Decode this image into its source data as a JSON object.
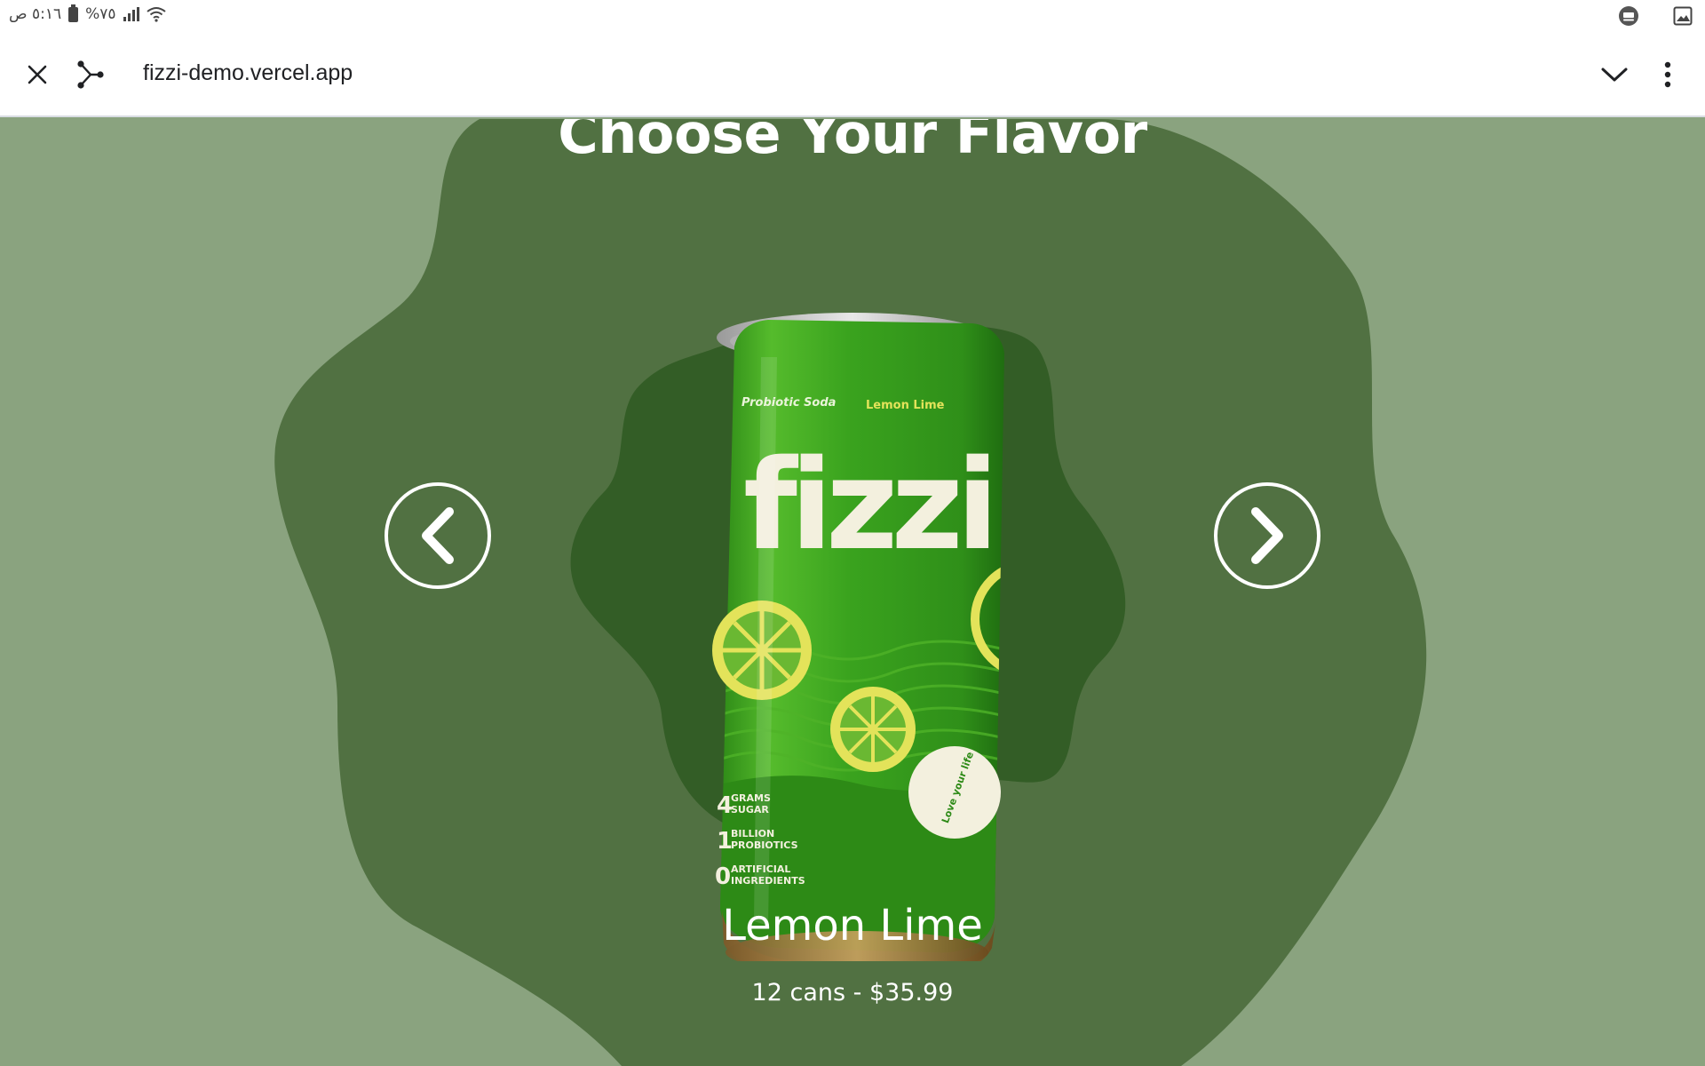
{
  "status_bar": {
    "time": "٥:١٦ ص",
    "battery": "%٧٥"
  },
  "browser": {
    "url": "fizzi-demo.vercel.app"
  },
  "page": {
    "heading": "Choose Your Flavor",
    "flavor_name": "Lemon Lime",
    "price": "12 cans - $35.99",
    "can": {
      "brand": "fizzi",
      "top_left_text": "Probiotic Soda",
      "top_right_text": "Lemon Lime",
      "stats": [
        {
          "num": "4",
          "line1": "GRAMS",
          "line2": "SUGAR"
        },
        {
          "num": "1",
          "line1": "BILLION",
          "line2": "PROBIOTICS"
        },
        {
          "num": "0",
          "line1": "ARTIFICIAL",
          "line2": "INGREDIENTS"
        }
      ],
      "badge_text": "Love your life"
    }
  },
  "colors": {
    "page_background": "#8aa37f",
    "outer_blob": "#517142",
    "inner_blob": "#335d26",
    "can_green": "#3fa320",
    "lemon_yellow": "#e3e35a"
  },
  "icons": [
    "close-icon",
    "share-icon",
    "chevron-down-icon",
    "more-vert-icon",
    "chevron-left-icon",
    "chevron-right-icon",
    "ad-block-icon",
    "picture-icon",
    "wifi-icon",
    "signal-icon",
    "battery-icon"
  ]
}
